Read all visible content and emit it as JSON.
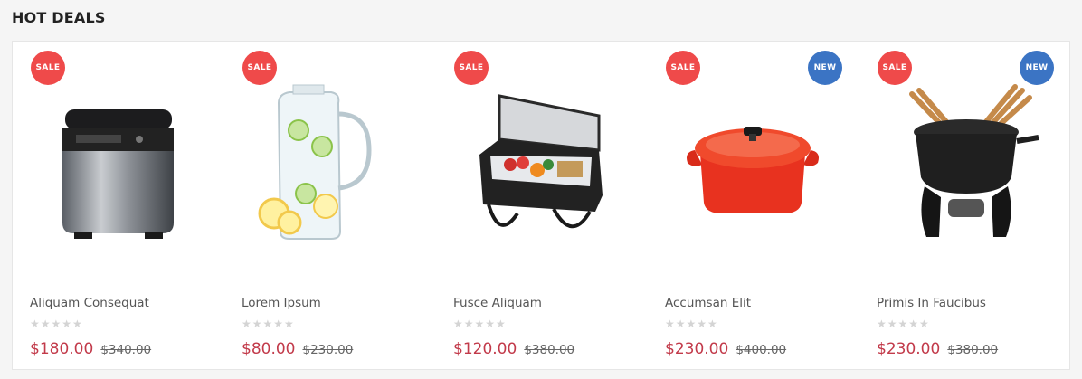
{
  "section": {
    "title": "HOT DEALS"
  },
  "products": [
    {
      "name": "Aliquam Consequat",
      "price": "$180.00",
      "old_price": "$340.00",
      "badges": [
        "SALE"
      ],
      "rating": 0,
      "stars": "★★★★★",
      "image": "bread-maker"
    },
    {
      "name": "Lorem Ipsum",
      "price": "$80.00",
      "old_price": "$230.00",
      "badges": [
        "SALE"
      ],
      "rating": 0,
      "stars": "★★★★★",
      "image": "glass-pitcher"
    },
    {
      "name": "Fusce Aliquam",
      "price": "$120.00",
      "old_price": "$380.00",
      "badges": [
        "SALE"
      ],
      "rating": 0,
      "stars": "★★★★★",
      "image": "cooler-bag"
    },
    {
      "name": "Accumsan Elit",
      "price": "$230.00",
      "old_price": "$400.00",
      "badges": [
        "SALE",
        "NEW"
      ],
      "rating": 0,
      "stars": "★★★★★",
      "image": "red-dutch-oven"
    },
    {
      "name": "Primis In Faucibus",
      "price": "$230.00",
      "old_price": "$380.00",
      "badges": [
        "SALE",
        "NEW"
      ],
      "rating": 0,
      "stars": "★★★★★",
      "image": "fondue-set"
    }
  ],
  "labels": {
    "sale": "SALE",
    "new": "NEW"
  },
  "colors": {
    "sale_badge": "#ef4a4a",
    "new_badge": "#3b74c4",
    "price": "#c23a4a"
  }
}
